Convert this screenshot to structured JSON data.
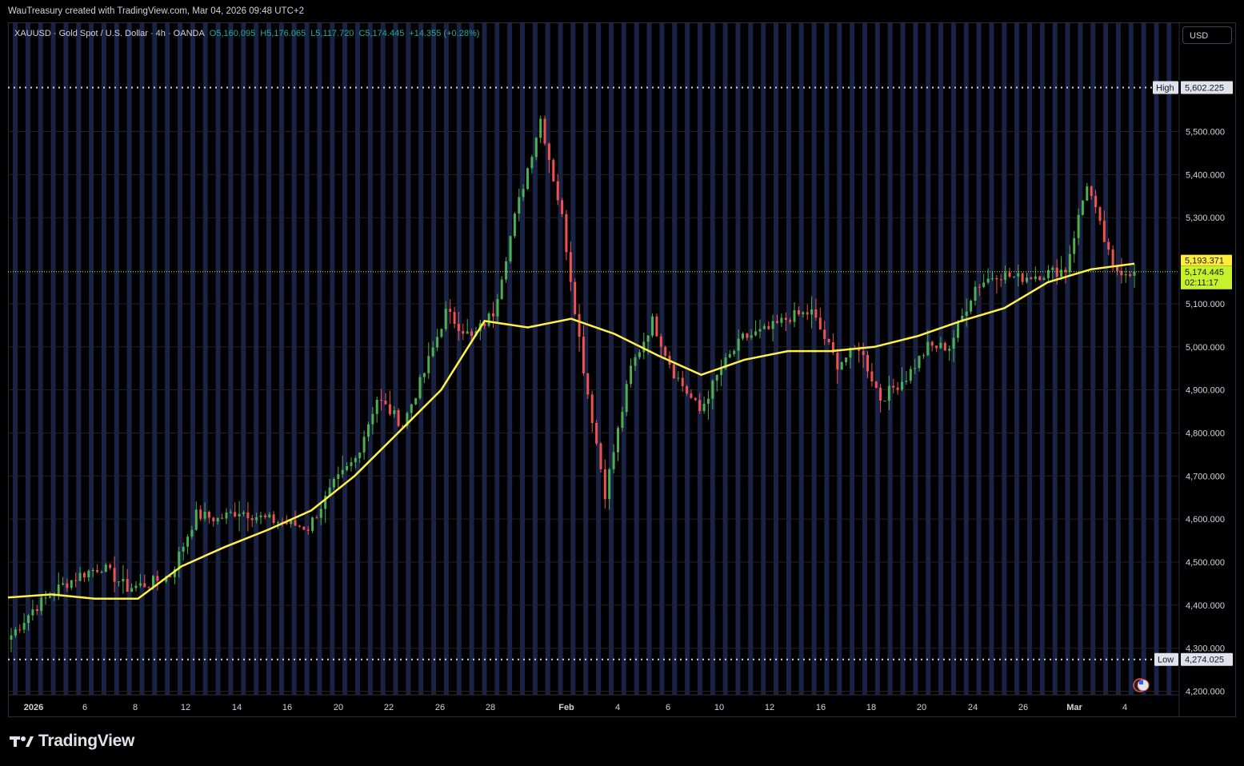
{
  "header": {
    "attribution": "WauTreasury created with TradingView.com, Mar 04, 2026 09:48 UTC+2"
  },
  "legend": {
    "symbol": "XAUUSD · Gold Spot / U.S. Dollar · 4h · OANDA",
    "open": "O5,160.095",
    "high": "H5,176.065",
    "low": "L5,117.720",
    "close": "C5,174.445",
    "change": "+14.355 (+0.28%)"
  },
  "currency_button": "USD",
  "brand": "TradingView",
  "colors": {
    "background": "#000000",
    "up": "#26a69a",
    "up_candle": "#4caf50",
    "down_candle": "#ef5350",
    "ma_line": "#fff04a",
    "session_band": "#1a2245",
    "price_label": "#c6f22b",
    "ma_label": "#ffeb3b"
  },
  "chart_data": {
    "type": "line",
    "title": "XAUUSD · Gold Spot / U.S. Dollar · 4h · OANDA",
    "x_ticks": [
      "2026",
      "6",
      "8",
      "12",
      "14",
      "16",
      "20",
      "22",
      "26",
      "28",
      "Feb",
      "4",
      "6",
      "10",
      "12",
      "16",
      "18",
      "20",
      "24",
      "26",
      "Mar",
      "4"
    ],
    "y_ticks": [
      "5,500.000",
      "5,400.000",
      "5,300.000",
      "5,100.000",
      "5,000.000",
      "4,900.000",
      "4,800.000",
      "4,700.000",
      "4,600.000",
      "4,500.000",
      "4,400.000",
      "4,300.000",
      "4,200.000"
    ],
    "ylim": [
      4180,
      5700
    ],
    "high_label": "High",
    "high_value": "5,602.225",
    "low_label": "Low",
    "low_value": "4,274.025",
    "last_price_label": "5,174.445",
    "countdown": "02:11:17",
    "ma_value_label": "5,193.371",
    "high": 5602.225,
    "low": 4274.025,
    "last_price": 5174.445,
    "ma_last": 5193.371,
    "price_series": {
      "name": "",
      "x": [
        "Jan 2",
        "Jan 3",
        "Jan 5",
        "Jan 6",
        "Jan 7",
        "Jan 8",
        "Jan 9",
        "Jan 10",
        "Jan 12",
        "Jan 13",
        "Jan 14",
        "Jan 15",
        "Jan 16",
        "Jan 17",
        "Jan 19",
        "Jan 20",
        "Jan 21",
        "Jan 22",
        "Jan 23",
        "Jan 24",
        "Jan 26",
        "Jan 27",
        "Jan 28",
        "Jan 29",
        "Jan 30",
        "Jan 31",
        "Feb 2",
        "Feb 3",
        "Feb 4",
        "Feb 5",
        "Feb 6",
        "Feb 7",
        "Feb 9",
        "Feb 10",
        "Feb 11",
        "Feb 12",
        "Feb 13",
        "Feb 16",
        "Feb 17",
        "Feb 18",
        "Feb 19",
        "Feb 20",
        "Feb 23",
        "Feb 24",
        "Feb 25",
        "Feb 26",
        "Feb 27",
        "Mar 2",
        "Mar 3",
        "Mar 4"
      ],
      "values": [
        4330,
        4390,
        4440,
        4470,
        4490,
        4440,
        4450,
        4470,
        4610,
        4600,
        4620,
        4600,
        4590,
        4580,
        4680,
        4740,
        4880,
        4820,
        4940,
        5080,
        5020,
        5080,
        5300,
        5530,
        5300,
        4950,
        4660,
        4950,
        5060,
        4940,
        4850,
        4950,
        5020,
        5040,
        5070,
        5080,
        4960,
        5000,
        4880,
        4930,
        5000,
        5000,
        5140,
        5170,
        5160,
        5170,
        5180,
        5380,
        5180,
        5174
      ]
    },
    "ma_series": {
      "name": "",
      "x": [
        "Jan 2",
        "Jan 6",
        "Jan 9",
        "Jan 12",
        "Jan 14",
        "Jan 16",
        "Jan 19",
        "Jan 21",
        "Jan 23",
        "Jan 26",
        "Jan 28",
        "Jan 30",
        "Feb 2",
        "Feb 4",
        "Feb 6",
        "Feb 9",
        "Feb 11",
        "Feb 12",
        "Feb 16",
        "Feb 18",
        "Feb 20",
        "Feb 24",
        "Feb 26",
        "Feb 27",
        "Mar 2",
        "Mar 3",
        "Mar 4"
      ],
      "values": [
        4418,
        4425,
        4415,
        4415,
        4490,
        4535,
        4575,
        4620,
        4700,
        4800,
        4900,
        5060,
        5045,
        5065,
        5030,
        4980,
        4935,
        4970,
        4990,
        4990,
        5000,
        5025,
        5060,
        5090,
        5150,
        5180,
        5193
      ]
    }
  }
}
